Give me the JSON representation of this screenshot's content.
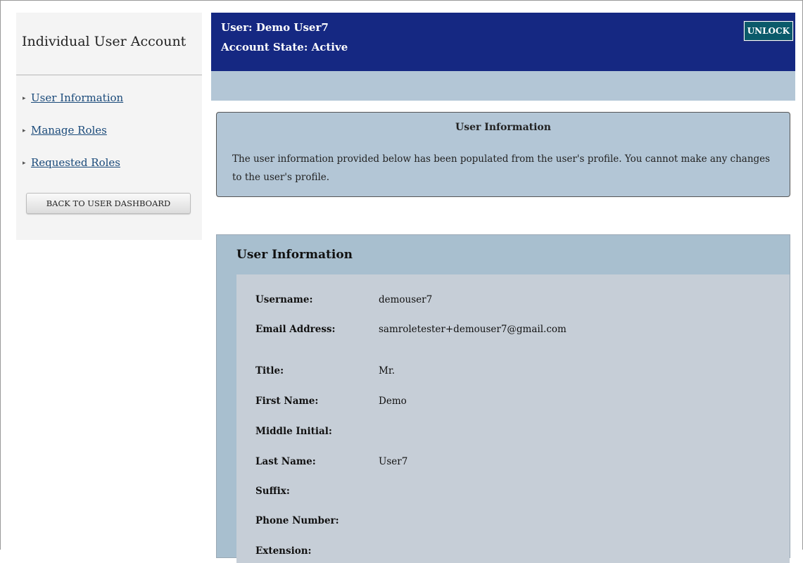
{
  "sidebar": {
    "title": "Individual User Account",
    "nav": [
      {
        "label": "User Information"
      },
      {
        "label": "Manage Roles"
      },
      {
        "label": "Requested Roles"
      }
    ],
    "back_button": "BACK TO USER DASHBOARD"
  },
  "header": {
    "user_line": "User: Demo User7",
    "state_line": "Account State: Active",
    "unlock_label": "UNLOCK"
  },
  "notice": {
    "title": "User Information",
    "text": "The user information provided below has been populated from the user's profile. You cannot make any changes to the user's profile."
  },
  "panel": {
    "title": "User Information",
    "fields": [
      {
        "label": "Username:",
        "value": "demouser7"
      },
      {
        "label": "Email Address:",
        "value": "samroletester+demouser7@gmail.com"
      },
      {
        "label": "Title:",
        "value": "Mr."
      },
      {
        "label": "First Name:",
        "value": "Demo"
      },
      {
        "label": "Middle Initial:",
        "value": ""
      },
      {
        "label": "Last Name:",
        "value": "User7"
      },
      {
        "label": "Suffix:",
        "value": ""
      },
      {
        "label": "Phone Number:",
        "value": ""
      },
      {
        "label": "Extension:",
        "value": ""
      }
    ]
  },
  "colors": {
    "header_bg": "#152882",
    "panel_bg": "#a8bfcf",
    "notice_bg": "#b3c6d6",
    "unlock_bg": "#0b5a6a"
  }
}
